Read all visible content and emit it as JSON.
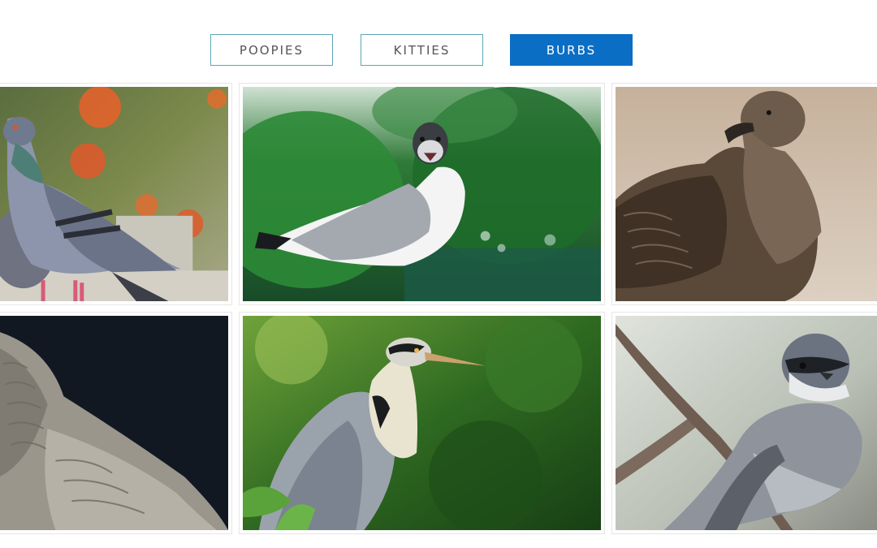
{
  "filters": {
    "items": [
      {
        "label": "POOPIES"
      },
      {
        "label": "KITTIES"
      },
      {
        "label": "BURBS"
      }
    ],
    "active": "BURBS",
    "colors": {
      "active_bg": "#0b6ec5",
      "border": "#5fa6b9",
      "text": "#555555"
    }
  },
  "gallery": {
    "tiles": [
      {
        "subject": "pigeons-photo"
      },
      {
        "subject": "gull-photo"
      },
      {
        "subject": "brown-seabird-photo"
      },
      {
        "subject": "grey-bird-closeup-photo"
      },
      {
        "subject": "heron-photo"
      },
      {
        "subject": "small-bird-on-branch-photo"
      }
    ]
  }
}
